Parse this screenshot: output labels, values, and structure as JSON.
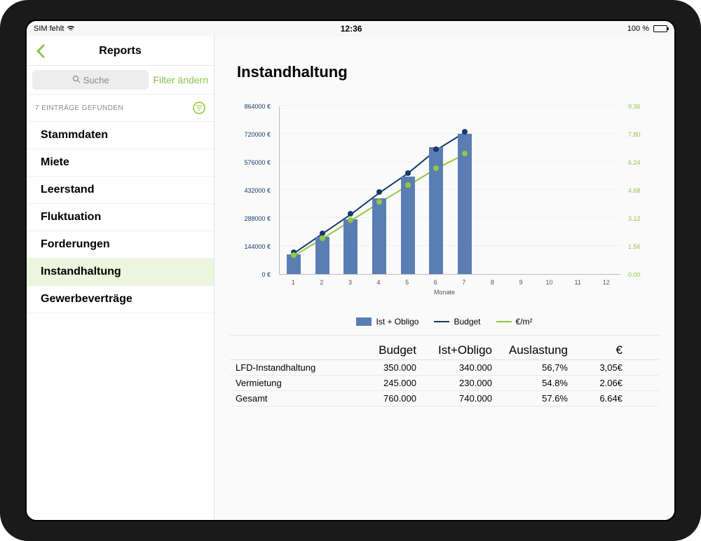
{
  "status": {
    "sim": "SIM fehlt",
    "time": "12:36",
    "battery": "100 %"
  },
  "nav": {
    "title": "Reports"
  },
  "search": {
    "placeholder": "Suche",
    "filter_link": "Filter ändern"
  },
  "results": {
    "label": "7 EINTRÄGE GEFUNDEN"
  },
  "sidebar": {
    "items": [
      {
        "label": "Stammdaten"
      },
      {
        "label": "Miete"
      },
      {
        "label": "Leerstand"
      },
      {
        "label": "Fluktuation"
      },
      {
        "label": "Forderungen"
      },
      {
        "label": "Instandhaltung"
      },
      {
        "label": "Gewerbeverträge"
      }
    ],
    "selected_index": 5
  },
  "page": {
    "title": "Instandhaltung"
  },
  "chart_data": {
    "type": "bar+line",
    "x_axis_label": "Monate",
    "categories": [
      "1",
      "2",
      "3",
      "4",
      "5",
      "6",
      "7",
      "8",
      "9",
      "10",
      "11",
      "12"
    ],
    "y_left_ticks": [
      "0 €",
      "144000 €",
      "288000 €",
      "432000 €",
      "576000 €",
      "720000 €",
      "864000 €"
    ],
    "y_left_max": 864000,
    "y_right_ticks": [
      "0.00",
      "1.56",
      "3.12",
      "4.68",
      "6.24",
      "7.80",
      "9.36"
    ],
    "y_right_max": 9.36,
    "series": [
      {
        "name": "Ist + Obligo",
        "kind": "bar",
        "color": "#5a7eb3",
        "values": [
          100000,
          190000,
          280000,
          390000,
          500000,
          650000,
          720000,
          null,
          null,
          null,
          null,
          null
        ]
      },
      {
        "name": "Budget",
        "kind": "line",
        "color": "#163a69",
        "values": [
          110000,
          210000,
          310000,
          420000,
          520000,
          640000,
          730000,
          null,
          null,
          null,
          null,
          null
        ]
      },
      {
        "name": "€/m²",
        "kind": "line",
        "color": "#92c742",
        "right_axis": true,
        "values": [
          1.05,
          2.0,
          3.0,
          4.0,
          4.95,
          5.9,
          6.7,
          null,
          null,
          null,
          null,
          null
        ]
      }
    ]
  },
  "legend": {
    "bar": "Ist + Obligo",
    "budget": "Budget",
    "rate": "€/m²"
  },
  "table": {
    "headers": [
      "",
      "Budget",
      "Ist+Obligo",
      "Auslastung",
      "€"
    ],
    "rows": [
      {
        "label": "LFD-Instandhaltung",
        "budget": "350.000",
        "ist": "340.000",
        "ausl": "56,7%",
        "eur": "3,05€"
      },
      {
        "label": "Vermietung",
        "budget": "245.000",
        "ist": "230.000",
        "ausl": "54.8%",
        "eur": "2.06€"
      },
      {
        "label": "Gesamt",
        "budget": "760.000",
        "ist": "740.000",
        "ausl": "57.6%",
        "eur": "6.64€"
      }
    ]
  }
}
